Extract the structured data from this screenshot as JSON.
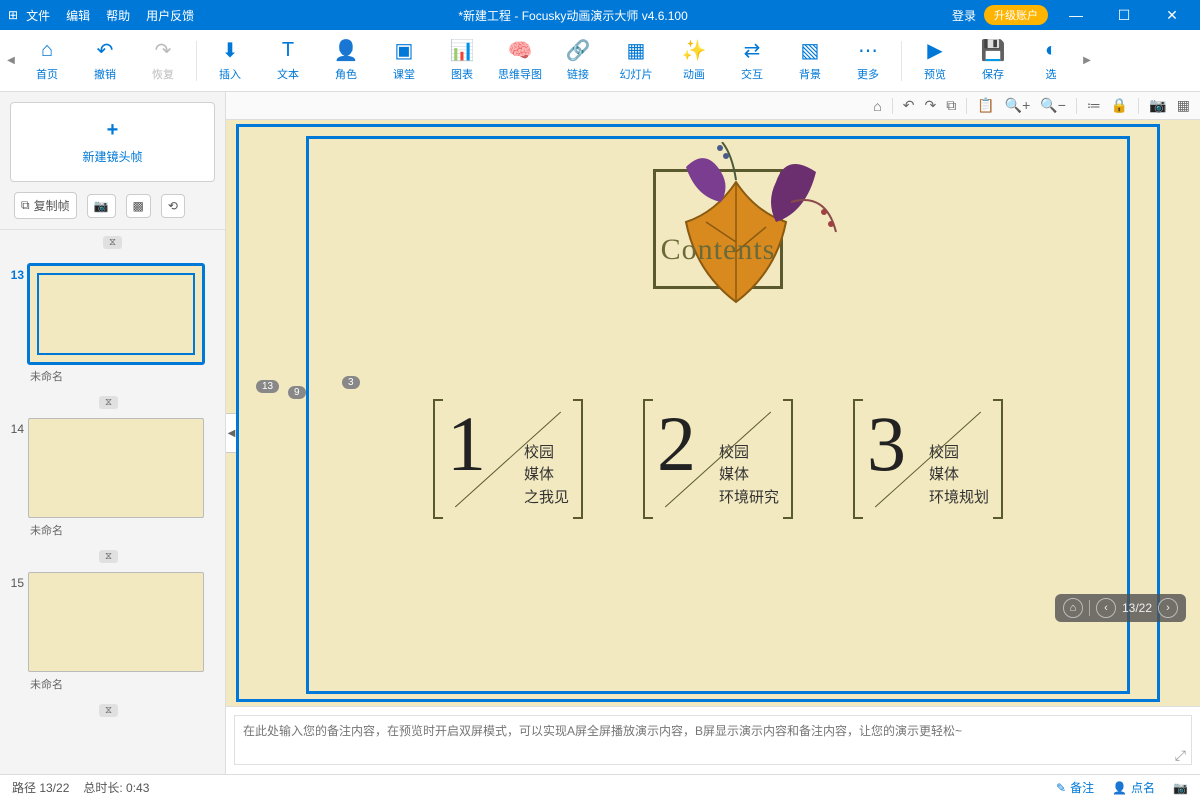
{
  "titlebar": {
    "menus": [
      "文件",
      "编辑",
      "帮助",
      "用户反馈"
    ],
    "title": "*新建工程 - Focusky动画演示大师  v4.6.100",
    "login": "登录",
    "upgrade": "升级账户"
  },
  "toolbar": {
    "left": [
      {
        "icon": "⌂",
        "label": "首页",
        "name": "home-button"
      },
      {
        "icon": "↶",
        "label": "撤销",
        "name": "undo-button"
      },
      {
        "icon": "↷",
        "label": "恢复",
        "name": "redo-button",
        "disabled": true
      }
    ],
    "mid": [
      {
        "icon": "⬇",
        "label": "插入",
        "name": "insert-button"
      },
      {
        "icon": "T",
        "label": "文本",
        "name": "text-button"
      },
      {
        "icon": "👤",
        "label": "角色",
        "name": "role-button"
      },
      {
        "icon": "▣",
        "label": "课堂",
        "name": "class-button"
      },
      {
        "icon": "📊",
        "label": "图表",
        "name": "chart-button"
      },
      {
        "icon": "🧠",
        "label": "思维导图",
        "name": "mindmap-button"
      },
      {
        "icon": "🔗",
        "label": "链接",
        "name": "link-button"
      },
      {
        "icon": "▦",
        "label": "幻灯片",
        "name": "slide-button"
      },
      {
        "icon": "✨",
        "label": "动画",
        "name": "animation-button"
      },
      {
        "icon": "⇄",
        "label": "交互",
        "name": "interact-button"
      },
      {
        "icon": "▧",
        "label": "背景",
        "name": "background-button"
      },
      {
        "icon": "⋯",
        "label": "更多",
        "name": "more-button"
      }
    ],
    "right": [
      {
        "icon": "▶",
        "label": "预览",
        "name": "preview-button"
      },
      {
        "icon": "💾",
        "label": "保存",
        "name": "save-button"
      },
      {
        "icon": "◐",
        "label": "选",
        "name": "select-button"
      }
    ]
  },
  "canvas_toolbar_icons": [
    "⌂",
    "↶",
    "↷",
    "⧉",
    "📋",
    "🔍+",
    "🔍−",
    "≔",
    "🔒",
    "📷",
    "▦"
  ],
  "sidebar": {
    "new_frame_label": "新建镜头帧",
    "copy_label": "复制帧",
    "frames": [
      {
        "num": "13",
        "label": "未命名",
        "active": true
      },
      {
        "num": "14",
        "label": "未命名",
        "active": false
      },
      {
        "num": "15",
        "label": "未命名",
        "active": false
      }
    ],
    "timer_icon": "⧖"
  },
  "slide": {
    "contents_title": "Contents",
    "sections": [
      {
        "num": "1",
        "line1": "校园",
        "line2": "媒体",
        "line3": "之我见"
      },
      {
        "num": "2",
        "line1": "校园",
        "line2": "媒体",
        "line3": "环境研究"
      },
      {
        "num": "3",
        "line1": "校园",
        "line2": "媒体",
        "line3": "环境规划"
      }
    ],
    "markers": {
      "m1": "13",
      "m2": "9",
      "m3": "3"
    }
  },
  "nav_overlay": {
    "page": "13/22"
  },
  "notes": {
    "placeholder": "在此处输入您的备注内容，在预览时开启双屏模式，可以实现A屏全屏播放演示内容，B屏显示演示内容和备注内容，让您的演示更轻松~"
  },
  "statusbar": {
    "path": "路径 13/22",
    "duration": "总时长: 0:43",
    "notes_btn": "备注",
    "click_btn": "点名"
  }
}
